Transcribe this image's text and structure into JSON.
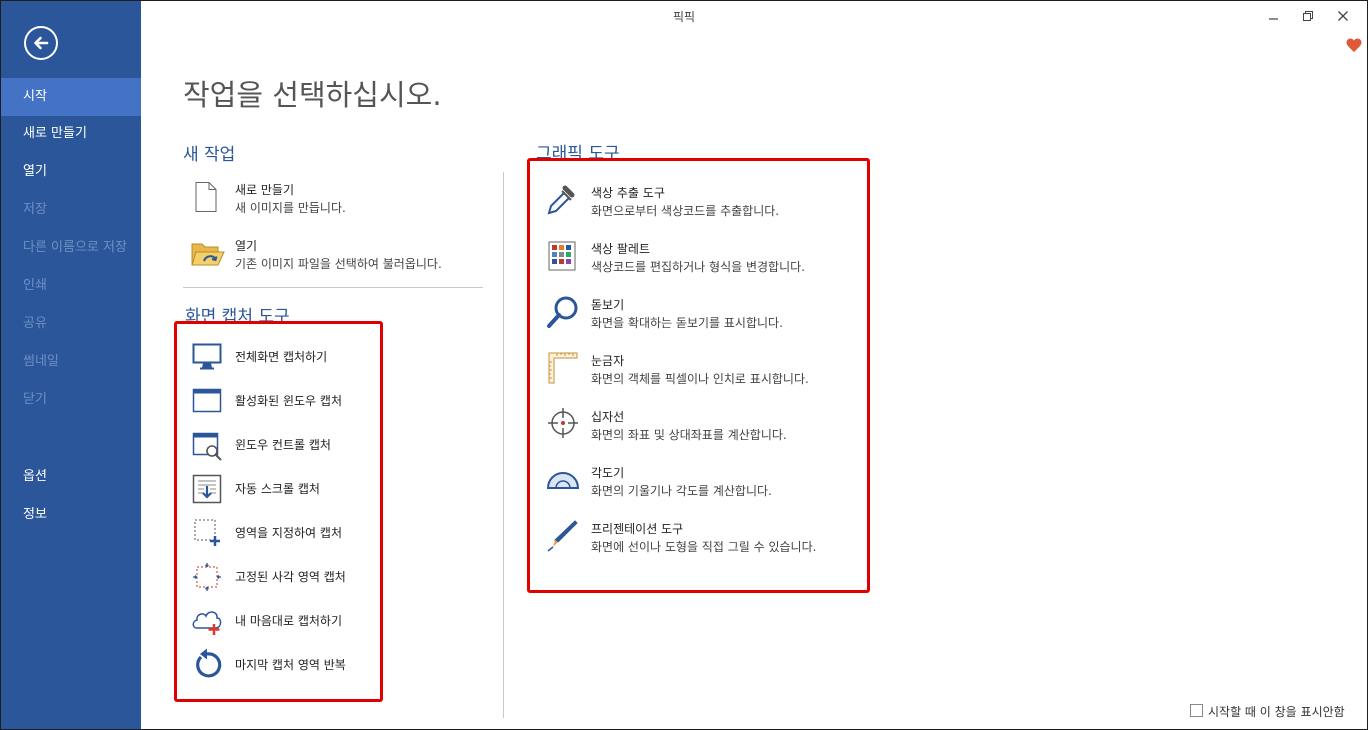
{
  "window": {
    "title": "픽픽"
  },
  "sidebar": {
    "items": [
      {
        "label": "시작",
        "state": "active"
      },
      {
        "label": "새로 만들기",
        "state": "enabled"
      },
      {
        "label": "열기",
        "state": "enabled"
      },
      {
        "label": "저장",
        "state": "disabled"
      },
      {
        "label": "다른 이름으로 저장",
        "state": "disabled"
      },
      {
        "label": "인쇄",
        "state": "disabled"
      },
      {
        "label": "공유",
        "state": "disabled"
      },
      {
        "label": "썸네일",
        "state": "disabled"
      },
      {
        "label": "닫기",
        "state": "disabled"
      },
      {
        "label": "옵션",
        "state": "enabled"
      },
      {
        "label": "정보",
        "state": "enabled"
      }
    ]
  },
  "main": {
    "heading": "작업을 선택하십시오.",
    "new_task": {
      "title": "새 작업",
      "items": [
        {
          "title": "새로 만들기",
          "desc": "새 이미지를 만듭니다.",
          "icon": "new-file-icon"
        },
        {
          "title": "열기",
          "desc": "기존 이미지 파일을 선택하여 불러옵니다.",
          "icon": "open-folder-icon"
        }
      ]
    },
    "capture_tools": {
      "title": "화면 캡처 도구",
      "items": [
        {
          "title": "전체화면 캡처하기",
          "icon": "monitor-icon"
        },
        {
          "title": "활성화된 윈도우 캡처",
          "icon": "window-icon"
        },
        {
          "title": "윈도우 컨트롤 캡처",
          "icon": "window-control-icon"
        },
        {
          "title": "자동 스크롤 캡처",
          "icon": "scroll-capture-icon"
        },
        {
          "title": "영역을 지정하여 캡처",
          "icon": "region-capture-icon"
        },
        {
          "title": "고정된 사각 영역 캡처",
          "icon": "fixed-region-icon"
        },
        {
          "title": "내 마음대로 캡처하기",
          "icon": "freehand-capture-icon"
        },
        {
          "title": "마지막 캡처 영역 반복",
          "icon": "repeat-capture-icon"
        }
      ]
    },
    "graphic_tools": {
      "title": "그래픽 도구",
      "items": [
        {
          "title": "색상 추출 도구",
          "desc": "화면으로부터 색상코드를 추출합니다.",
          "icon": "eyedropper-icon"
        },
        {
          "title": "색상 팔레트",
          "desc": "색상코드를 편집하거나 형식을 변경합니다.",
          "icon": "palette-icon"
        },
        {
          "title": "돋보기",
          "desc": "화면을 확대하는 돋보기를 표시합니다.",
          "icon": "magnifier-icon"
        },
        {
          "title": "눈금자",
          "desc": "화면의 객체를 픽셀이나 인치로 표시합니다.",
          "icon": "ruler-icon"
        },
        {
          "title": "십자선",
          "desc": "화면의 좌표 및 상대좌표를 계산합니다.",
          "icon": "crosshair-icon"
        },
        {
          "title": "각도기",
          "desc": "화면의 기울기나 각도를 계산합니다.",
          "icon": "protractor-icon"
        },
        {
          "title": "프리젠테이션 도구",
          "desc": "화면에 선이나 도형을 직접 그릴 수 있습니다.",
          "icon": "pen-icon"
        }
      ]
    }
  },
  "footer": {
    "checkbox_label": "시작할 때 이 창을 표시안함",
    "checked": false
  },
  "colors": {
    "sidebar": "#2b579a",
    "sidebar_active": "#4472c4",
    "accent_text": "#2b579a",
    "highlight_box": "#e00000",
    "heart": "#e05a3a"
  }
}
